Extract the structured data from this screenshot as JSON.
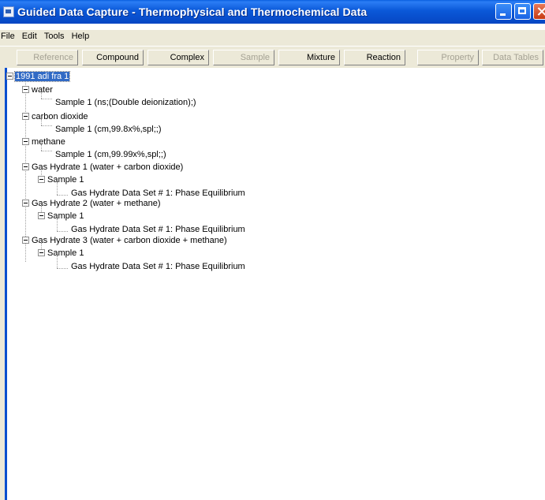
{
  "window": {
    "title": "Guided Data Capture - Thermophysical and Thermochemical Data"
  },
  "menu": [
    "File",
    "Edit",
    "Tools",
    "Help"
  ],
  "toolbar": [
    {
      "label": "Reference",
      "enabled": false
    },
    {
      "label": "Compound",
      "enabled": true
    },
    {
      "label": "Complex",
      "enabled": true
    },
    {
      "label": "Sample",
      "enabled": false
    },
    {
      "label": "Mixture",
      "enabled": true
    },
    {
      "label": "Reaction",
      "enabled": true
    },
    {
      "label": "Property",
      "enabled": false
    },
    {
      "label": "Data Tables",
      "enabled": false
    }
  ],
  "tree": {
    "root": "1991 adi fra 1",
    "nodes": [
      {
        "label": "water",
        "children": [
          "Sample 1 (ns;(Double deionization);)"
        ]
      },
      {
        "label": "carbon dioxide",
        "children": [
          "Sample 1 (cm,99.8x%,spl;;)"
        ]
      },
      {
        "label": "methane",
        "children": [
          "Sample 1 (cm,99.99x%,spl;;)"
        ]
      },
      {
        "label": "Gas Hydrate 1 (water + carbon dioxide)",
        "sample": "Sample 1",
        "dataset": "Gas Hydrate Data Set # 1: Phase Equilibrium"
      },
      {
        "label": "Gas Hydrate 2 (water + methane)",
        "sample": "Sample 1",
        "dataset": "Gas Hydrate Data Set # 1: Phase Equilibrium"
      },
      {
        "label": "Gas Hydrate 3 (water + carbon dioxide + methane)",
        "sample": "Sample 1",
        "dataset": "Gas Hydrate Data Set # 1: Phase Equilibrium"
      }
    ]
  }
}
